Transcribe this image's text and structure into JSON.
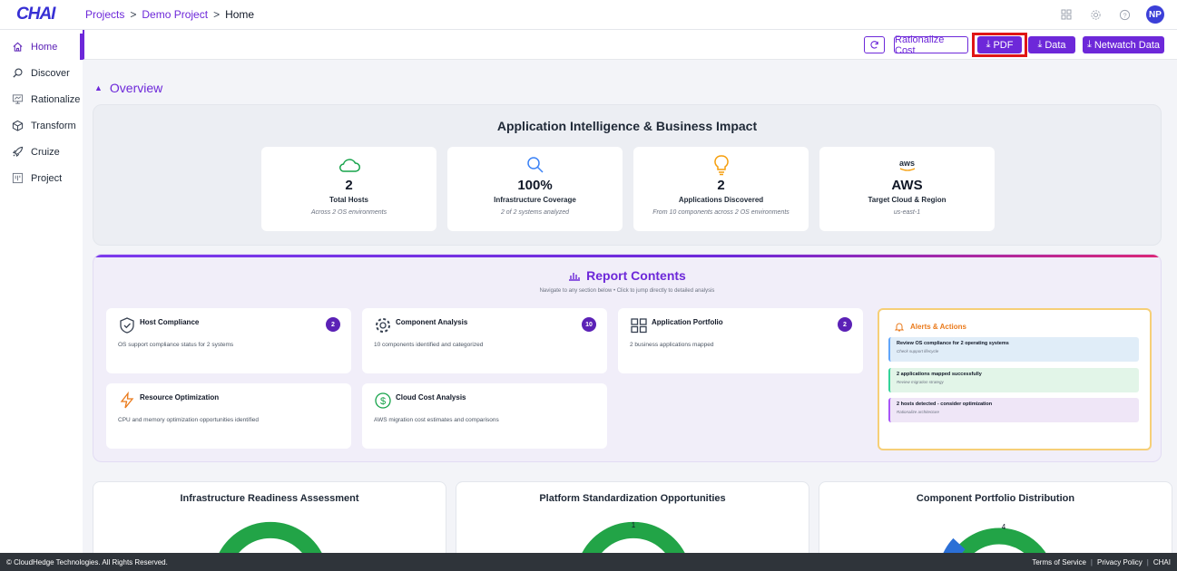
{
  "app": {
    "logo": "CHAI"
  },
  "breadcrumb": {
    "projects": "Projects",
    "sep1": ">",
    "project": "Demo Project",
    "sep2": ">",
    "current": "Home"
  },
  "user": {
    "initials": "NP"
  },
  "sidebar": {
    "items": [
      {
        "label": "Home",
        "icon": "home-icon"
      },
      {
        "label": "Discover",
        "icon": "search-icon"
      },
      {
        "label": "Rationalize",
        "icon": "monitor-icon"
      },
      {
        "label": "Transform",
        "icon": "cube-icon"
      },
      {
        "label": "Cruize",
        "icon": "rocket-icon"
      },
      {
        "label": "Project",
        "icon": "board-icon"
      }
    ]
  },
  "toolbar": {
    "rationalize_cost": "Rationalize Cost",
    "pdf": "PDF",
    "data": "Data",
    "netwatch": "Netwatch Data"
  },
  "overview": {
    "label": "Overview",
    "title": "Application Intelligence & Business Impact",
    "stats": [
      {
        "value": "2",
        "label": "Total Hosts",
        "sub": "Across 2 OS environments",
        "icon": "cloud-icon"
      },
      {
        "value": "100%",
        "label": "Infrastructure Coverage",
        "sub": "2 of 2 systems analyzed",
        "icon": "search-icon"
      },
      {
        "value": "2",
        "label": "Applications Discovered",
        "sub": "From 10 components across 2 OS environments",
        "icon": "lightbulb-icon"
      },
      {
        "value": "AWS",
        "label": "Target Cloud & Region",
        "sub": "us-east-1",
        "icon": "aws-logo",
        "logo_text": "aws"
      }
    ]
  },
  "report": {
    "title": "Report Contents",
    "subtitle": "Navigate to any section below • Click to jump directly to detailed analysis",
    "cards": [
      {
        "title": "Host Compliance",
        "desc": "OS support compliance status for 2 systems",
        "badge": "2"
      },
      {
        "title": "Component Analysis",
        "desc": "10 components identified and categorized",
        "badge": "10"
      },
      {
        "title": "Application Portfolio",
        "desc": "2 business applications mapped",
        "badge": "2"
      },
      {
        "title": "Resource Optimization",
        "desc": "CPU and memory optimization opportunities identified"
      },
      {
        "title": "Cloud Cost Analysis",
        "desc": "AWS migration cost estimates and comparisons"
      }
    ],
    "alerts": {
      "title": "Alerts & Actions",
      "items": [
        {
          "title": "Review OS compliance for 2 operating systems",
          "sub": "Check support lifecycle",
          "color": "#e0edf8",
          "border": "#60a5fa"
        },
        {
          "title": "2 applications mapped successfully",
          "sub": "Review migration strategy",
          "color": "#e2f5e8",
          "border": "#34d399"
        },
        {
          "title": "2 hosts detected - consider optimization",
          "sub": "Rationalize architecture",
          "color": "#efe6f7",
          "border": "#a855f7"
        }
      ]
    }
  },
  "charts": [
    {
      "title": "Infrastructure Readiness Assessment",
      "label": ""
    },
    {
      "title": "Platform Standardization Opportunities",
      "label": "1"
    },
    {
      "title": "Component Portfolio Distribution",
      "label": "4"
    }
  ],
  "footer": {
    "copyright": "© CloudHedge Technologies. All Rights Reserved.",
    "terms": "Terms of Service",
    "privacy": "Privacy Policy",
    "brand": "CHAI"
  },
  "colors": {
    "accent": "#6d28d9",
    "donut_green": "#22a447",
    "donut_blue": "#2b6fd6",
    "highlight": "#e01515"
  }
}
